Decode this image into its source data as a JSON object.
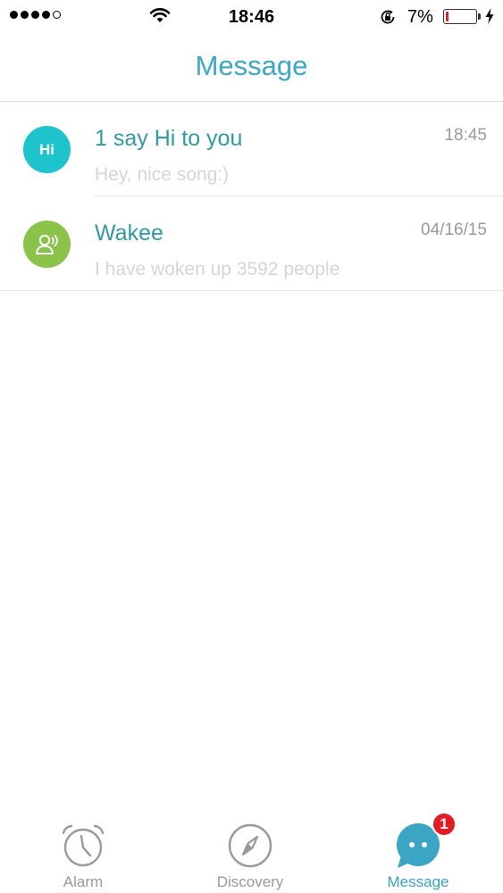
{
  "status_bar": {
    "time": "18:46",
    "battery_percent": "7%",
    "signal_bars": 4,
    "signal_total": 5,
    "battery_level": 0.07
  },
  "header": {
    "title": "Message"
  },
  "messages": [
    {
      "avatar_text": "Hi",
      "title": "1 say Hi to you",
      "time": "18:45",
      "preview": "Hey, nice song:)"
    },
    {
      "avatar_icon": "speaker-user-icon",
      "title": "Wakee",
      "time": "04/16/15",
      "preview": "I have woken up 3592 people"
    }
  ],
  "tabs": [
    {
      "label": "Alarm",
      "icon": "alarm-clock-icon"
    },
    {
      "label": "Discovery",
      "icon": "compass-icon"
    },
    {
      "label": "Message",
      "icon": "chat-bubble-icon",
      "badge": "1",
      "active": true
    }
  ],
  "colors": {
    "accent": "#39a8c4",
    "title_text": "#2f9aa2",
    "hi_avatar": "#1ec4cc",
    "wakee_avatar": "#8bc34a",
    "badge": "#e31b23",
    "battery_low": "#e8202a"
  }
}
